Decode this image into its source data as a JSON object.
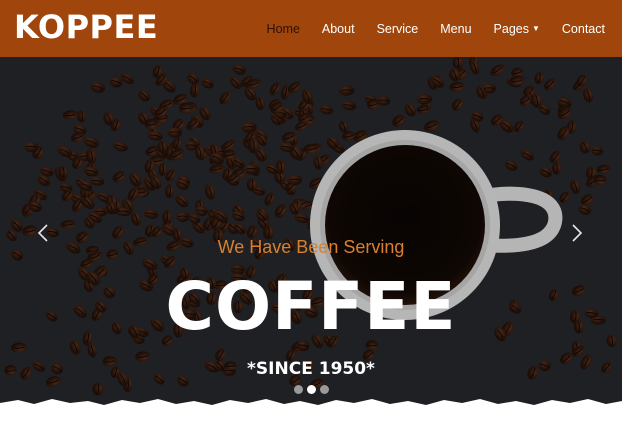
{
  "brand": {
    "name": "KOPPEE"
  },
  "nav": {
    "items": [
      {
        "label": "Home",
        "active": true
      },
      {
        "label": "About",
        "active": false
      },
      {
        "label": "Service",
        "active": false
      },
      {
        "label": "Menu",
        "active": false
      },
      {
        "label": "Pages",
        "active": false
      },
      {
        "label": "Contact",
        "active": false
      }
    ]
  },
  "hero": {
    "subtitle": "We Have Been Serving",
    "title": "COFFEE",
    "since": "*SINCE 1950*",
    "slide_count": 3,
    "active_slide": 2
  },
  "icons": {
    "prev": "chevron-left-icon",
    "next": "chevron-right-icon",
    "pages_caret": "caret-down-icon"
  },
  "colors": {
    "navbar": "#a0460c",
    "accent": "#d9802f",
    "hero_background": "#26272b",
    "active_nav_text": "#2a1205"
  }
}
